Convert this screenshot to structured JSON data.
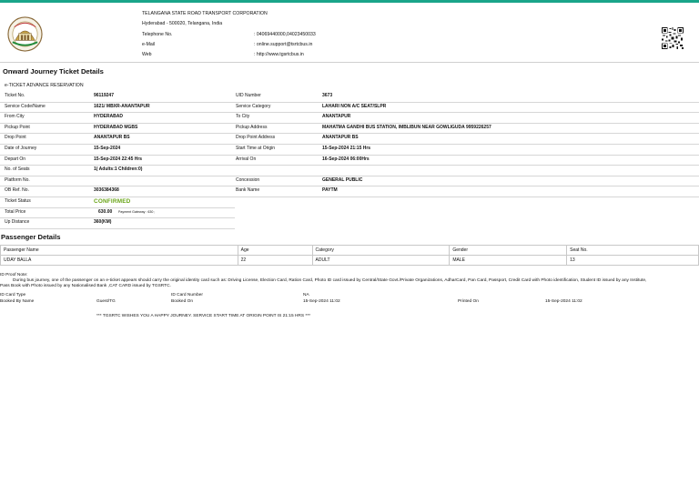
{
  "org": {
    "name": "TELANGANA STATE ROAD TRANSPORT CORPORATION",
    "address": "Hyderabad - 500020, Telangana, India",
    "contacts": [
      {
        "label": "Telephone No.",
        "value": ": 04069440000,04023450033"
      },
      {
        "label": "e-Mail",
        "value": ": online.support@tsrtcbus.in"
      },
      {
        "label": "Web",
        "value": ": http://www.tgsrtcbus.in"
      }
    ]
  },
  "journey": {
    "title": "Onward Journey Ticket Details",
    "subtitle": "e-TICKET ADVANCE RESERVATION",
    "rows": [
      {
        "l1": "Ticket No.",
        "v1": "96119247",
        "l2": "UID Number",
        "v2": "3673"
      },
      {
        "l1": "Service Code/Name",
        "v1": "1621/ MBXR-ANANTAPUR",
        "l2": "Service Category",
        "v2": "LAHARI NON A/C SEAT/SLPR"
      },
      {
        "l1": "From City",
        "v1": "HYDERABAD",
        "l2": "To City",
        "v2": "ANANTAPUR"
      },
      {
        "l1": "Pickup Point",
        "v1": "HYDERABAD MGBS",
        "l2": "Pickup Address",
        "v2": "MAHATMA GANDHI BUS STATION, IMBLIBUN NEAR GOWLIGUDA 9959226257"
      },
      {
        "l1": "Drop Point",
        "v1": "ANANTAPUR BS",
        "l2": "Drop Point Address",
        "v2": "ANANTAPUR BS"
      },
      {
        "l1": "Date of Journey",
        "v1": "15-Sep-2024",
        "l2": "Start Time at Origin",
        "v2": "15-Sep-2024 21:15 Hrs"
      },
      {
        "l1": "Depart On",
        "v1": "15-Sep-2024  22:45 Hrs",
        "l2": "Arrival On",
        "v2": "16-Sep-2024  06:00Hrs"
      },
      {
        "l1": "No. of Seats",
        "v1": "1( Adults:1  Children:0)",
        "l2": "",
        "v2": ""
      },
      {
        "l1": "Platform No.",
        "v1": "",
        "l2": "Concession",
        "v2": "GENERAL PUBLIC"
      },
      {
        "l1": "OB Ref. No.",
        "v1": "3036384368",
        "l2": "Bank Name",
        "v2": "PAYTM"
      },
      {
        "l1": "Ticket Status",
        "v1": "CONFIRMED",
        "l2": "",
        "v2": ""
      },
      {
        "l1": "Total Price",
        "v1": "630.00",
        "note": "Payment Gateway : 630 ;",
        "l2": "",
        "v2": ""
      },
      {
        "l1": "Up Distance",
        "v1": "360(KM)",
        "l2": "",
        "v2": ""
      }
    ]
  },
  "passenger": {
    "title": "Passenger Details",
    "headers": [
      "Passenger Name",
      "Age",
      "Category",
      "Gender",
      "Seat No."
    ],
    "rows": [
      [
        "UDAY BALLA",
        "22",
        "ADULT",
        "MALE",
        "13"
      ]
    ]
  },
  "idproof": {
    "heading": "ID Proof Note:",
    "line1": "During bus journey, one of the passenger on an e-ticket appears should carry the original identity card such as: Driving License, Election Card, Ration Card, Photo ID card issued by Central/State Govt./Private Organizations, AdharCard, Pan Card, Passport, Credit Card with Photo identification, Student ID issued by any Institute,",
    "line2": "Pass Book with Photo issued by any Nationalised Bank ,CAT CARD issued by TGSRTC.",
    "id_card_type_label": "ID Card Type",
    "id_card_number_label": "ID Card Number",
    "id_card_number_value": "NA",
    "booked_by_label": "Booked By Name",
    "booked_by_value": "Guest/TG",
    "booked_on_label": "Booked On",
    "booked_on_value": "15-Sep-2024 11:02",
    "printed_on_label": "Printed On",
    "printed_on_value": "15-Sep-2024 11:02"
  },
  "wish": "*** TGSRTC WISHES YOU A HAPPY JOURNEY. SERVICE START TIME AT ORIGIN POINT IS 21:15 HRS ***",
  "colors": {
    "accent": "#1aa58a",
    "confirmed": "#6aa519"
  },
  "icons": {
    "logo": "tsrtc-emblem-icon",
    "qr": "qr-code-icon"
  }
}
